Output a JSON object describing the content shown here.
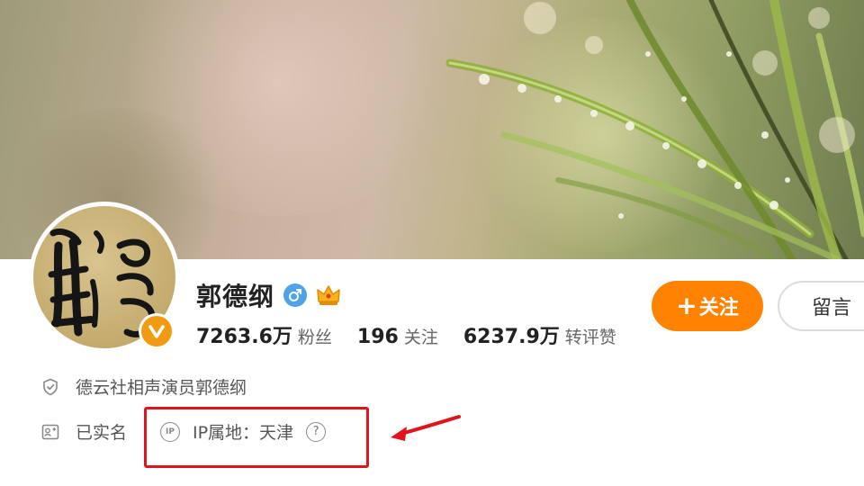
{
  "profile": {
    "name": "郭德纲",
    "gender_icon": "male-icon",
    "badge_icon": "crown-icon",
    "verified_icon": "verified-v-icon",
    "avatar_calligraphy": "胃三"
  },
  "stats": [
    {
      "value": "7263.6万",
      "label": "粉丝"
    },
    {
      "value": "196",
      "label": "关注"
    },
    {
      "value": "6237.9万",
      "label": "转评赞"
    }
  ],
  "actions": {
    "follow_label": "关注",
    "follow_plus": "+",
    "message_label": "留言"
  },
  "info": {
    "description": "德云社相声演员郭德纲",
    "real_name_status": "已实名",
    "ip_icon_text": "IP",
    "ip_location": "IP属地：天津",
    "help_icon": "?"
  },
  "colors": {
    "accent": "#ff8200",
    "verified": "#f39a13",
    "gender": "#4fa3e8",
    "annotation": "#e0141e"
  }
}
